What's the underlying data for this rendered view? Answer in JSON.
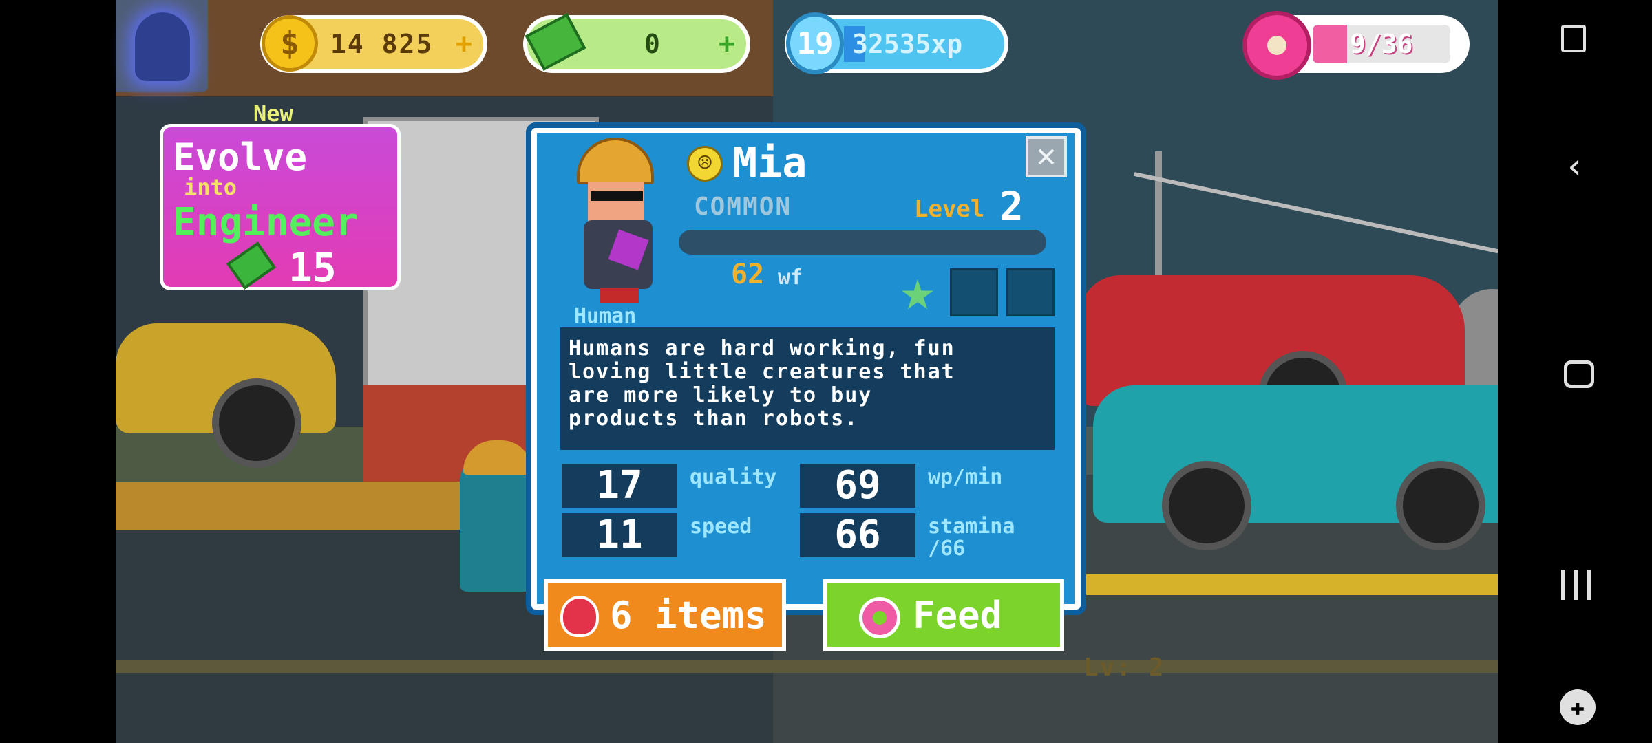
{
  "hud": {
    "coins": "14 825",
    "coins_plus": "+",
    "cash": "0",
    "cash_plus": "+",
    "player_level": "19",
    "xp": "32535xp",
    "xp_progress": 0.1,
    "donuts": "9/36",
    "donut_progress": 0.25
  },
  "evolve": {
    "new_label": "New",
    "line1": "Evolve",
    "line2": "into",
    "line3": "Engineer",
    "cost": "15"
  },
  "character": {
    "name": "Mia",
    "mood_icon": "sad-face-icon",
    "rarity": "COMMON",
    "level_label": "Level",
    "level_value": "2",
    "species": "Human",
    "wf_value": "62",
    "wf_unit": "wf",
    "stars": {
      "filled": 1,
      "total": 3
    },
    "description": "Humans are hard working, fun\nloving little creatures that\nare more likely to buy\nproducts than robots.",
    "stats": {
      "quality_value": "17",
      "quality_label": "quality",
      "wp_value": "69",
      "wp_label": "wp/min",
      "speed_value": "11",
      "speed_label": "speed",
      "stamina_value": "66",
      "stamina_label": "stamina\n/66"
    },
    "close_symbol": "✕"
  },
  "actions": {
    "items_label": "6 items",
    "feed_label": "Feed"
  },
  "background": {
    "level_hint": "Lv: 2"
  },
  "colors": {
    "dialog_bg": "#1e8fd0",
    "evolve_bg": "#e33bb3",
    "items_button": "#f08a1c",
    "feed_button": "#7bd32c",
    "gold": "#f2b12d"
  }
}
